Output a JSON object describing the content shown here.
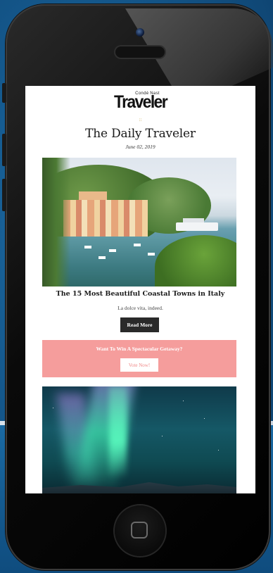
{
  "newsletter": {
    "brand_small": "Condé Nast",
    "brand_name": "Traveler",
    "divider": "::",
    "title": "The Daily Traveler",
    "date": "June 02, 2019"
  },
  "article": {
    "image_alt": "Portofino harbor, Italy",
    "headline": "The 15 Most Beautiful Coastal Towns in Italy",
    "subhead": "La dolce vita, indeed.",
    "button_label": "Read More"
  },
  "promo": {
    "text": "Want To Win A Spectacular Getaway?",
    "button_label": "Vote Now!",
    "color": "#f59d9c"
  },
  "second_article": {
    "image_alt": "Northern lights"
  },
  "colors": {
    "button_dark": "#2a2a2a",
    "accent_gold": "#c7a64a"
  }
}
